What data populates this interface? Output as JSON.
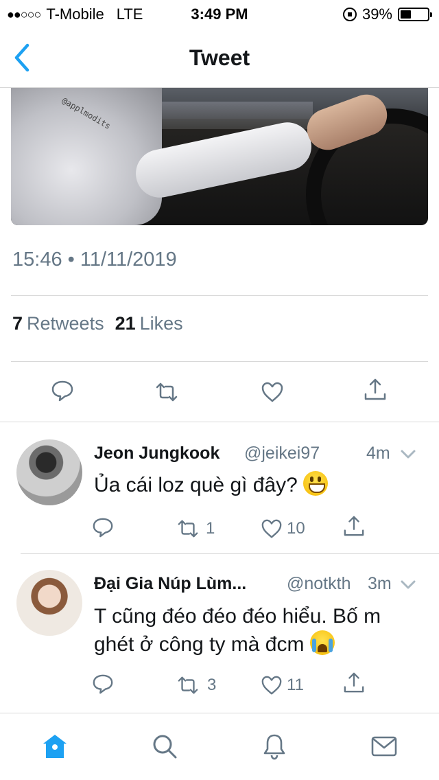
{
  "status_bar": {
    "signal": "●●○○○",
    "carrier": "T-Mobile",
    "network": "LTE",
    "time": "3:49 PM",
    "battery_percent": "39%",
    "battery_level": 0.39
  },
  "nav": {
    "title": "Tweet",
    "back_icon": "chevron-left-icon"
  },
  "tweet": {
    "timestamp": "15:46 • 11/11/2019",
    "media_watermark": "@applmodits",
    "stats": {
      "retweets_count": "7",
      "retweets_label": "Retweets",
      "likes_count": "21",
      "likes_label": "Likes"
    },
    "actions": [
      "reply-icon",
      "retweet-icon",
      "like-icon",
      "share-icon"
    ]
  },
  "replies": [
    {
      "name": "Jeon Jungkook",
      "handle": "@jeikei97",
      "time": "4m",
      "text": "Ủa cái loz què gì đây?",
      "emoji": "grinning-face-emoji",
      "retweets": "1",
      "likes": "10"
    },
    {
      "name": "Đại Gia Núp Lùm...",
      "handle": "@notkth",
      "time": "3m",
      "text": "T cũng đéo đéo đéo hiểu. Bố m ghét ở công ty mà đcm",
      "emoji": "loudly-crying-face-emoji",
      "retweets": "3",
      "likes": "11"
    }
  ],
  "tabbar": {
    "tabs": [
      "home-icon",
      "search-icon",
      "notifications-icon",
      "messages-icon"
    ],
    "active_color": "#1da1f2"
  },
  "colors": {
    "accent": "#1da1f2",
    "secondary_text": "#657786",
    "primary_text": "#14171a",
    "divider": "#d8d8d8"
  }
}
